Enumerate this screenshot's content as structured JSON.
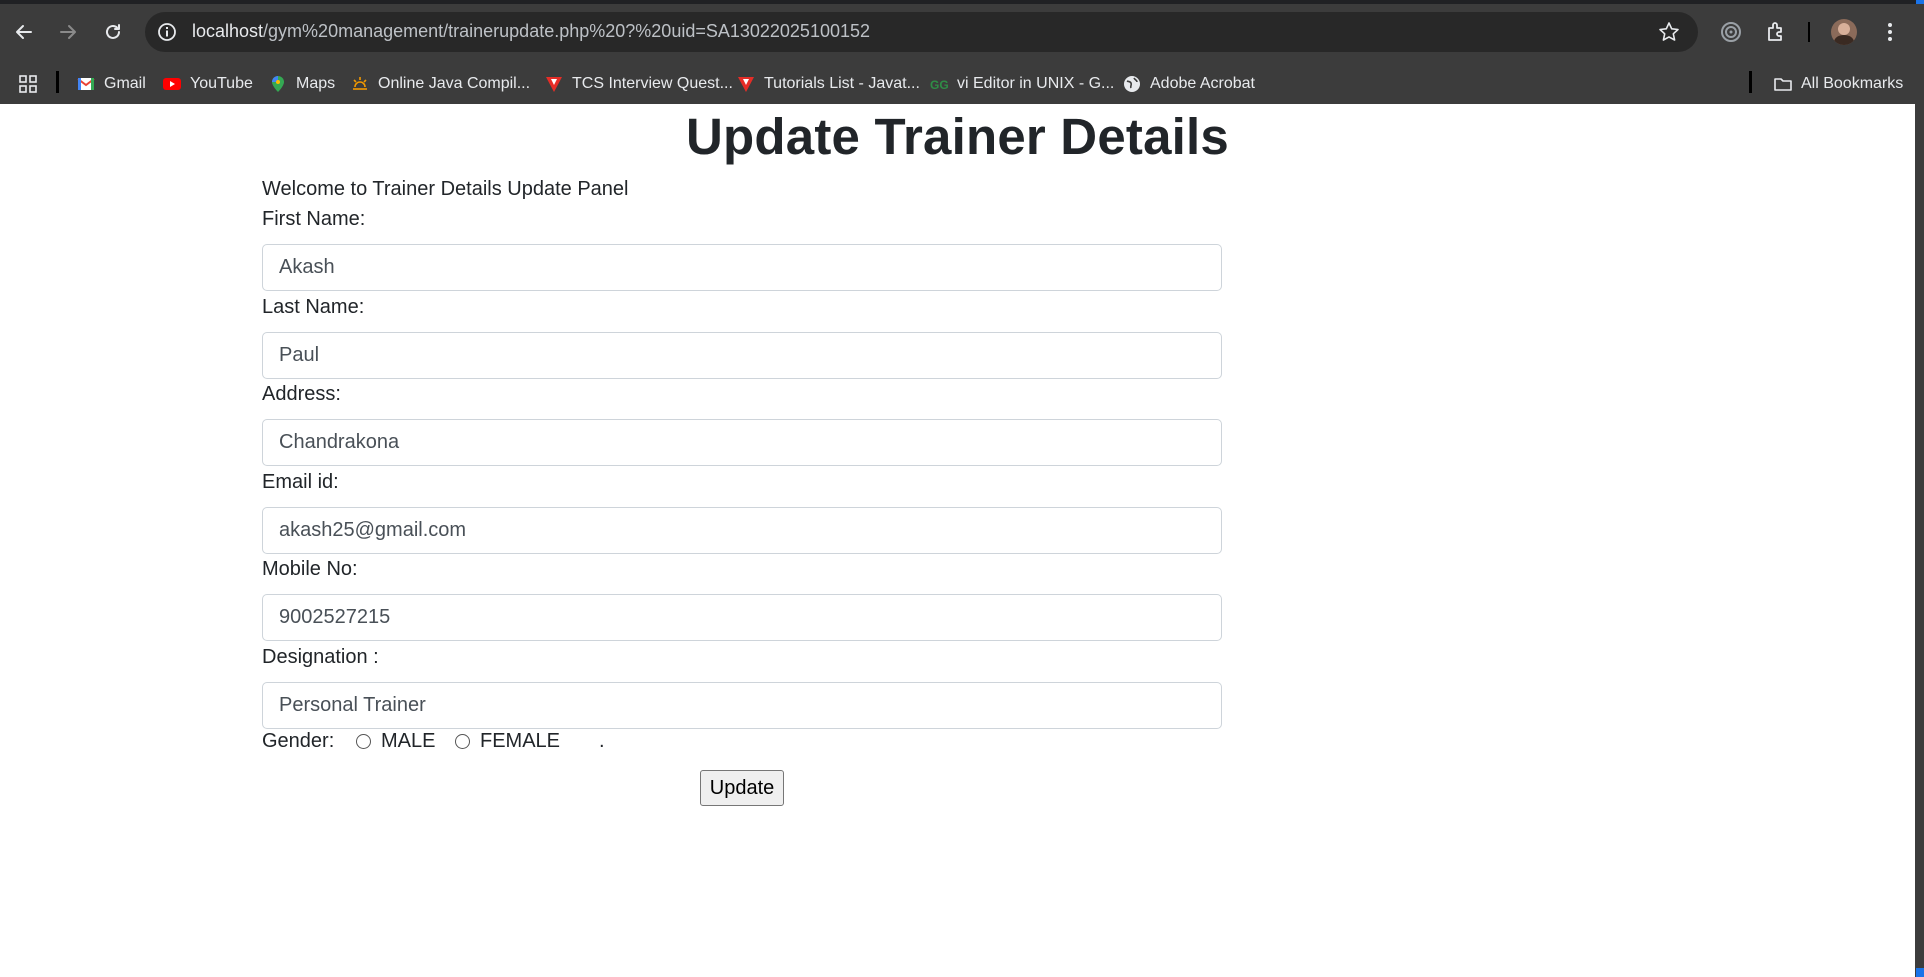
{
  "browser": {
    "url_host": "localhost",
    "url_path": "/gym%20management/trainerupdate.php%20?%20uid=SA13022025100152",
    "bookmarks": [
      {
        "label": "Gmail",
        "icon": "gmail-icon"
      },
      {
        "label": "YouTube",
        "icon": "youtube-icon"
      },
      {
        "label": "Maps",
        "icon": "maps-icon"
      },
      {
        "label": "Online Java Compil...",
        "icon": "compiler-icon"
      },
      {
        "label": "TCS Interview Quest...",
        "icon": "javatpoint-icon"
      },
      {
        "label": "Tutorials List - Javat...",
        "icon": "javatpoint-icon"
      },
      {
        "label": "vi Editor in UNIX - G...",
        "icon": "geeksforgeeks-icon"
      },
      {
        "label": "Adobe Acrobat",
        "icon": "globe-icon"
      }
    ],
    "all_bookmarks_label": "All Bookmarks"
  },
  "page": {
    "title": "Update Trainer Details",
    "welcome": "Welcome to Trainer Details Update Panel",
    "fields": {
      "first_name_label": "First Name:",
      "first_name_value": "Akash",
      "last_name_label": "Last Name:",
      "last_name_value": "Paul",
      "address_label": "Address:",
      "address_value": "Chandrakona",
      "email_label": "Email id:",
      "email_value": "akash25@gmail.com",
      "mobile_label": "Mobile No:",
      "mobile_value": "9002527215",
      "designation_label": "Designation :",
      "designation_value": "Personal Trainer"
    },
    "gender": {
      "label": "Gender:",
      "male": "MALE",
      "female": "FEMALE",
      "trailing": "."
    },
    "update_button": "Update"
  },
  "colors": {
    "chrome_bg": "#3c3c3c",
    "omnibox_bg": "#282828",
    "text_dark": "#212529",
    "input_border": "#ced4da"
  }
}
